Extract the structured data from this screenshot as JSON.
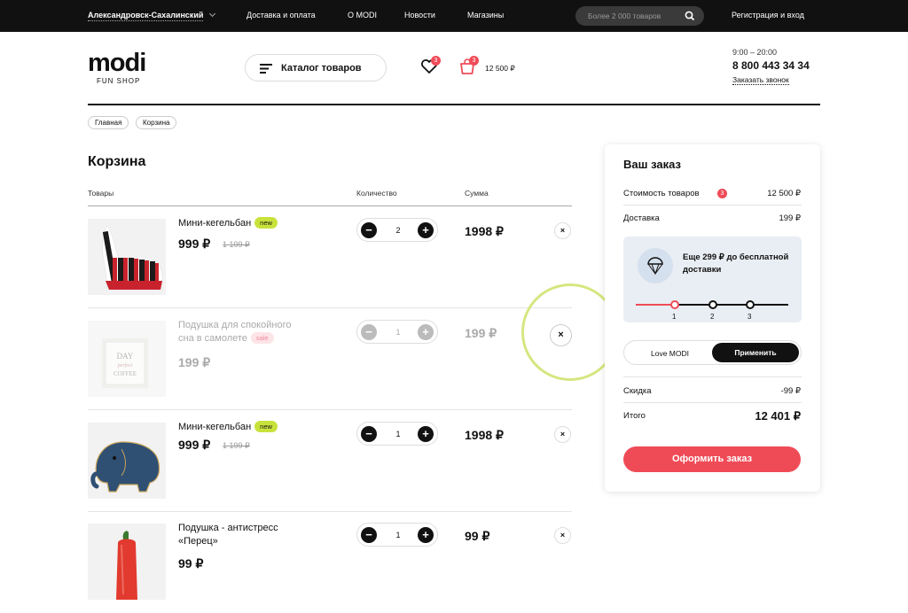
{
  "topbar": {
    "city": "Александровск-Сахалинский",
    "nav": [
      "Доставка и оплата",
      "О MODI",
      "Новости",
      "Магазины"
    ],
    "search_placeholder": "Более 2 000 товаров",
    "auth": "Регистрация и вход"
  },
  "header": {
    "logo": "modi",
    "logo_sub": "FUN SHOP",
    "catalog": "Каталог товаров",
    "fav_count": "3",
    "cart_count": "3",
    "cart_sum": "12 500 ₽",
    "hours": "9:00 – 20:00",
    "phone": "8 800 443 34 34",
    "callback": "Заказать звонок"
  },
  "breadcrumbs": [
    "Главная",
    "Корзина"
  ],
  "cart": {
    "title": "Корзина",
    "col_goods": "Товары",
    "col_qty": "Количество",
    "col_sum": "Сумма",
    "items": [
      {
        "name": "Мини-кегельбан",
        "tag": "new",
        "price": "999 ₽",
        "old_price": "1 199 ₽",
        "qty": "2",
        "sum": "1998 ₽"
      },
      {
        "name_line1": "Подушка для спокойного",
        "name_line2": "сна в самолете",
        "tag": "sale",
        "price": "199 ₽",
        "qty": "1",
        "sum": "199 ₽"
      },
      {
        "name": "Мини-кегельбан",
        "tag": "new",
        "price": "999 ₽",
        "old_price": "1 199 ₽",
        "qty": "1",
        "sum": "1998 ₽"
      },
      {
        "name_line1": "Подушка - антистресс",
        "name_line2": "«Перец»",
        "price": "99 ₽",
        "qty": "1",
        "sum": "99 ₽"
      }
    ],
    "plus": "+",
    "minus": "−",
    "delete": "×"
  },
  "order": {
    "title": "Ваш заказ",
    "goods_cost_label": "Стоимость товаров",
    "goods_count": "3",
    "goods_cost": "12 500 ₽",
    "delivery_label": "Доставка",
    "delivery": "199 ₽",
    "free_delivery_text": "Еще 299 ₽ до бесплатной доставки",
    "steps": [
      "1",
      "2",
      "3"
    ],
    "promo_value": "Love MODI",
    "apply": "Применить",
    "discount_label": "Скидка",
    "discount": "-99 ₽",
    "total_label": "Итого",
    "total": "12 401 ₽",
    "checkout": "Оформить заказ"
  },
  "colors": {
    "accent": "#ef4b57",
    "new_tag": "#c9e23b",
    "highlight_ring": "#d6e680"
  }
}
